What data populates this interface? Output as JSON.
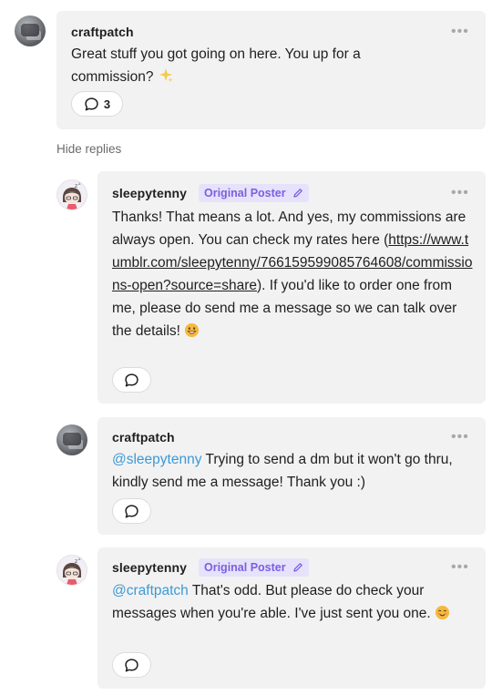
{
  "comments": [
    {
      "username": "craftpatch",
      "text": "Great stuff you got going on here. You up for a commission?",
      "emoji": "sparkles",
      "reply_count": "3"
    },
    {
      "username": "sleepytenny",
      "badge": "Original Poster",
      "text_before_link": "Thanks! That means a lot. And yes, my commissions are always open. You can check my rates here (",
      "link": "https://www.tumblr.com/sleepytenny/766159599085764608/commissions-open?source=share",
      "text_after_link": "). If you'd like to order one from me, please do send me a message so we can talk over the details!",
      "emoji": "grinning-face"
    },
    {
      "username": "craftpatch",
      "mention": "@sleepytenny",
      "text": " Trying to send a dm but it won't go thru, kindly send me a message! Thank you :)"
    },
    {
      "username": "sleepytenny",
      "badge": "Original Poster",
      "mention": "@craftpatch",
      "text": " That's odd. But please do check your messages when you're able. I've just sent you one.",
      "emoji": "smiling-face"
    }
  ],
  "hide_replies_label": "Hide replies",
  "more_icon": "more-dots-icon",
  "colors": {
    "card_bg": "#f2f2f2",
    "badge_bg": "#e7e2fb",
    "badge_text": "#7b5fe0",
    "mention": "#3b9ad6"
  }
}
